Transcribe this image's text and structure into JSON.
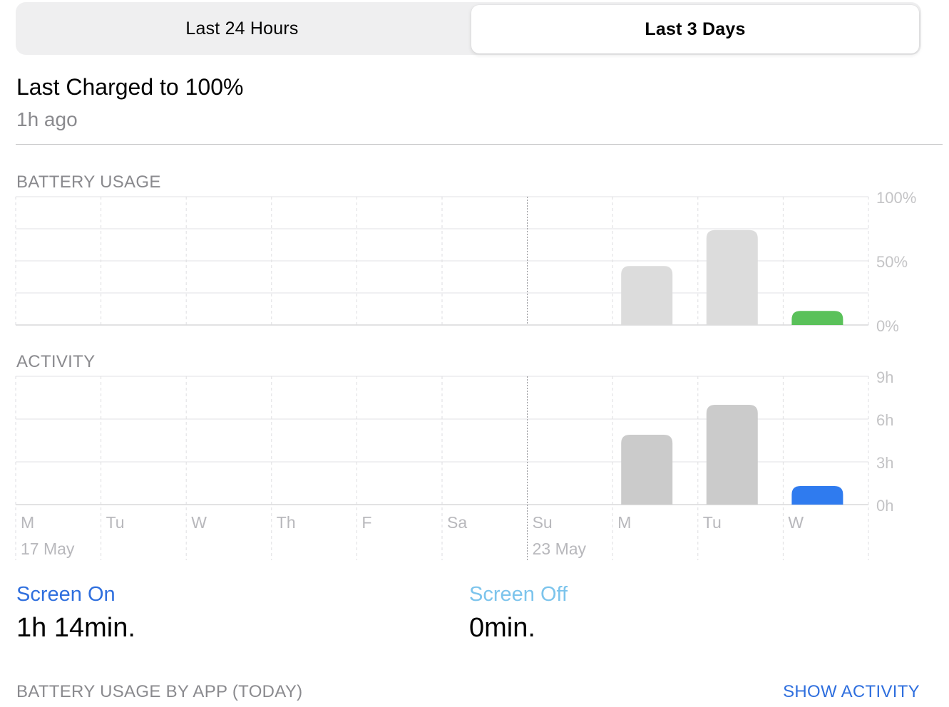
{
  "tabs": {
    "left_label": "Last 24 Hours",
    "right_label": "Last 3 Days"
  },
  "last_charged": {
    "title": "Last Charged to 100%",
    "subtitle": "1h ago"
  },
  "sections": {
    "battery_usage": "BATTERY USAGE",
    "activity": "ACTIVITY",
    "by_app": "BATTERY USAGE BY APP (TODAY)",
    "show_activity": "SHOW ACTIVITY"
  },
  "stats": {
    "screen_on_label": "Screen On",
    "screen_on_value": "1h 14min.",
    "screen_off_label": "Screen Off",
    "screen_off_value": "0min."
  },
  "colors": {
    "accent": "#2f6fde",
    "screen_off": "#7cc4ec",
    "battery_today": "#5ac15a",
    "activity_today": "#2f7bef",
    "bar_past": "#dcdcdc",
    "activity_past": "#cbcbcb"
  },
  "chart_data": [
    {
      "type": "bar",
      "categories": [
        "M",
        "Tu",
        "W",
        "Th",
        "F",
        "Sa",
        "Su",
        "M",
        "Tu",
        "W"
      ],
      "date_labels": [
        "17 May",
        "",
        "",
        "",
        "",
        "",
        "23 May",
        "",
        "",
        ""
      ],
      "values": [
        0,
        0,
        0,
        0,
        0,
        0,
        0,
        46,
        74,
        11
      ],
      "highlight_index": 9,
      "y_ticks": [
        "100%",
        "50%",
        "0%"
      ],
      "ylim": [
        0,
        100
      ],
      "grid": true
    },
    {
      "type": "bar",
      "categories": [
        "M",
        "Tu",
        "W",
        "Th",
        "F",
        "Sa",
        "Su",
        "M",
        "Tu",
        "W"
      ],
      "date_labels": [
        "17 May",
        "",
        "",
        "",
        "",
        "",
        "23 May",
        "",
        "",
        ""
      ],
      "values": [
        0,
        0,
        0,
        0,
        0,
        0,
        0,
        4.9,
        7.0,
        1.3
      ],
      "highlight_index": 9,
      "y_ticks": [
        "9h",
        "6h",
        "3h",
        "0h"
      ],
      "ylim": [
        0,
        9
      ],
      "grid": true
    }
  ]
}
